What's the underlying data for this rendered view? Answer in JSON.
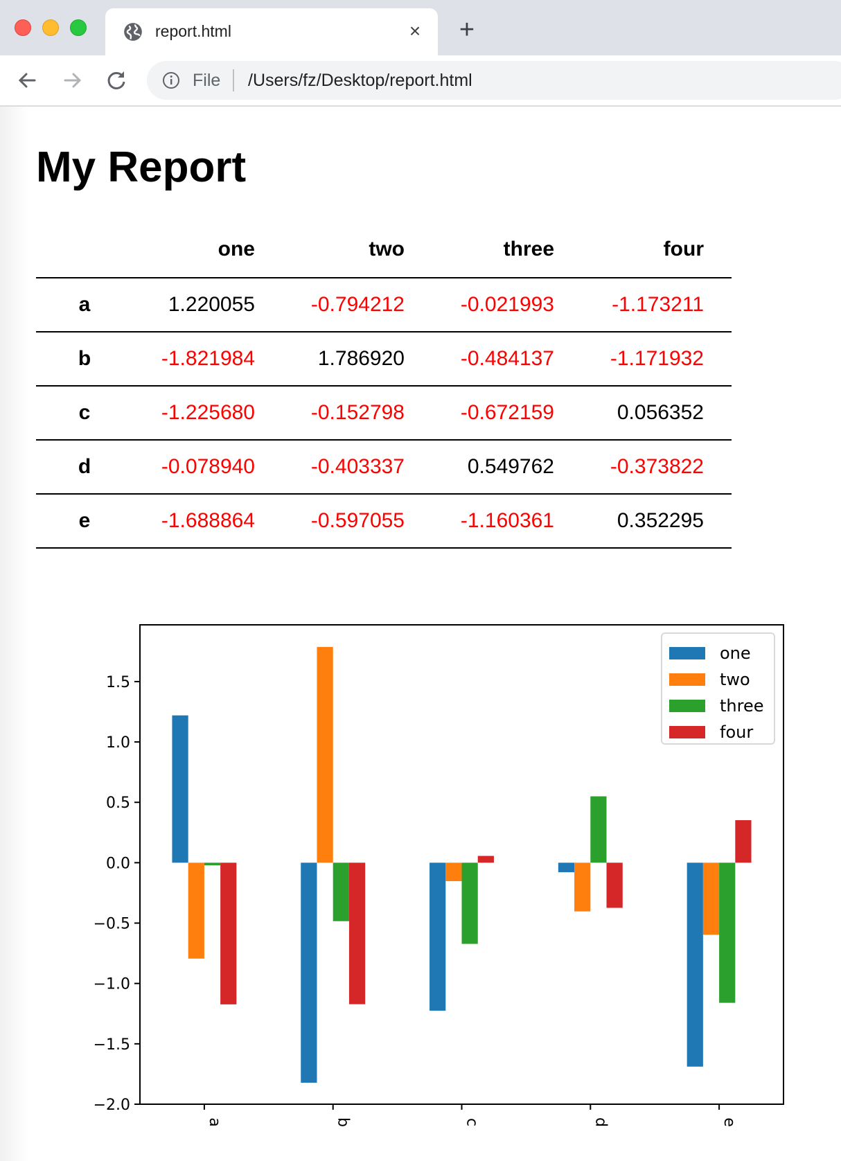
{
  "browser": {
    "tab_title": "report.html",
    "close_icon": "×",
    "new_tab_icon": "+",
    "omnibox": {
      "scheme_label": "File",
      "url": "/Users/fz/Desktop/report.html"
    }
  },
  "page": {
    "title": "My Report",
    "table": {
      "columns": [
        "one",
        "two",
        "three",
        "four"
      ],
      "rows": [
        {
          "index": "a",
          "values": [
            "1.220055",
            "-0.794212",
            "-0.021993",
            "-1.173211"
          ]
        },
        {
          "index": "b",
          "values": [
            "-1.821984",
            "1.786920",
            "-0.484137",
            "-1.171932"
          ]
        },
        {
          "index": "c",
          "values": [
            "-1.225680",
            "-0.152798",
            "-0.672159",
            "0.056352"
          ]
        },
        {
          "index": "d",
          "values": [
            "-0.078940",
            "-0.403337",
            "0.549762",
            "-0.373822"
          ]
        },
        {
          "index": "e",
          "values": [
            "-1.688864",
            "-0.597055",
            "-1.160361",
            "0.352295"
          ]
        }
      ],
      "negative_color": "#ff0000",
      "positive_color": "#000000"
    }
  },
  "chart_data": {
    "type": "bar",
    "title": "",
    "xlabel": "",
    "ylabel": "",
    "categories": [
      "a",
      "b",
      "c",
      "d",
      "e"
    ],
    "series": [
      {
        "name": "one",
        "color": "#1f77b4",
        "values": [
          1.220055,
          -1.821984,
          -1.22568,
          -0.07894,
          -1.688864
        ]
      },
      {
        "name": "two",
        "color": "#ff7f0e",
        "values": [
          -0.794212,
          1.78692,
          -0.152798,
          -0.403337,
          -0.597055
        ]
      },
      {
        "name": "three",
        "color": "#2ca02c",
        "values": [
          -0.021993,
          -0.484137,
          -0.672159,
          0.549762,
          -1.160361
        ]
      },
      {
        "name": "four",
        "color": "#d62728",
        "values": [
          -1.173211,
          -1.171932,
          0.056352,
          -0.373822,
          0.352295
        ]
      }
    ],
    "ylim": [
      -2.0,
      1.97
    ],
    "yticks": [
      -2.0,
      -1.5,
      -1.0,
      -0.5,
      0.0,
      0.5,
      1.0,
      1.5
    ],
    "ytick_labels": [
      "−2.0",
      "−1.5",
      "−1.0",
      "−0.5",
      "0.0",
      "0.5",
      "1.0",
      "1.5"
    ],
    "xtick_rotation": 90,
    "grid": false,
    "legend": {
      "position": "top-right",
      "entries": [
        "one",
        "two",
        "three",
        "four"
      ]
    }
  }
}
